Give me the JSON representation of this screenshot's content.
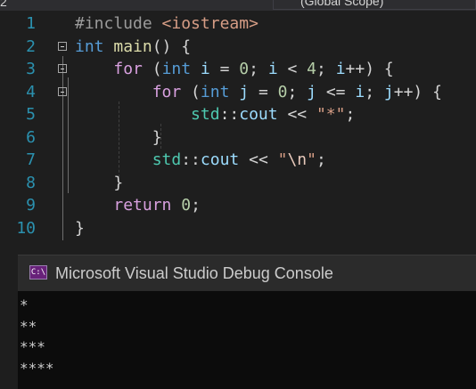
{
  "topbar": {
    "left_fragment": "2",
    "scope_label": "(Global Scope)"
  },
  "editor": {
    "lines": [
      {
        "num": "1",
        "parts": [
          [
            "pp",
            "#include "
          ],
          [
            "str",
            "<iostream>"
          ]
        ]
      },
      {
        "num": "2",
        "parts": [
          [
            "kw",
            "int"
          ],
          [
            "txt",
            " "
          ],
          [
            "fn",
            "main"
          ],
          [
            "txt",
            "() {"
          ]
        ]
      },
      {
        "num": "3",
        "parts": [
          [
            "txt",
            "    "
          ],
          [
            "ctrl",
            "for"
          ],
          [
            "txt",
            " ("
          ],
          [
            "kw",
            "int"
          ],
          [
            "txt",
            " "
          ],
          [
            "var",
            "i"
          ],
          [
            "txt",
            " = "
          ],
          [
            "num",
            "0"
          ],
          [
            "txt",
            "; "
          ],
          [
            "var",
            "i"
          ],
          [
            "txt",
            " < "
          ],
          [
            "num",
            "4"
          ],
          [
            "txt",
            "; "
          ],
          [
            "var",
            "i"
          ],
          [
            "txt",
            "++) {"
          ]
        ]
      },
      {
        "num": "4",
        "parts": [
          [
            "txt",
            "        "
          ],
          [
            "ctrl",
            "for"
          ],
          [
            "txt",
            " ("
          ],
          [
            "kw",
            "int"
          ],
          [
            "txt",
            " "
          ],
          [
            "var",
            "j"
          ],
          [
            "txt",
            " = "
          ],
          [
            "num",
            "0"
          ],
          [
            "txt",
            "; "
          ],
          [
            "var",
            "j"
          ],
          [
            "txt",
            " <= "
          ],
          [
            "var",
            "i"
          ],
          [
            "txt",
            "; "
          ],
          [
            "var",
            "j"
          ],
          [
            "txt",
            "++) {"
          ]
        ]
      },
      {
        "num": "5",
        "parts": [
          [
            "txt",
            "            "
          ],
          [
            "ns",
            "std"
          ],
          [
            "txt",
            "::"
          ],
          [
            "var",
            "cout"
          ],
          [
            "txt",
            " << "
          ],
          [
            "str",
            "\"*\""
          ],
          [
            "txt",
            ";"
          ]
        ]
      },
      {
        "num": "6",
        "parts": [
          [
            "txt",
            "        }"
          ]
        ]
      },
      {
        "num": "7",
        "parts": [
          [
            "txt",
            "        "
          ],
          [
            "ns",
            "std"
          ],
          [
            "txt",
            "::"
          ],
          [
            "var",
            "cout"
          ],
          [
            "txt",
            " << "
          ],
          [
            "str",
            "\""
          ],
          [
            "esc",
            "\\n"
          ],
          [
            "str",
            "\""
          ],
          [
            "txt",
            ";"
          ]
        ]
      },
      {
        "num": "8",
        "parts": [
          [
            "txt",
            "    }"
          ]
        ]
      },
      {
        "num": "9",
        "parts": [
          [
            "txt",
            "    "
          ],
          [
            "ctrl",
            "return"
          ],
          [
            "txt",
            " "
          ],
          [
            "num",
            "0"
          ],
          [
            "txt",
            ";"
          ]
        ]
      },
      {
        "num": "10",
        "parts": [
          [
            "txt",
            "}"
          ]
        ]
      }
    ]
  },
  "console": {
    "title": "Microsoft Visual Studio Debug Console",
    "icon_text": "C:\\",
    "output": [
      "*",
      "**",
      "***",
      "****"
    ]
  },
  "colors": {
    "background": "#1e1e1e",
    "line_number": "#2b91af",
    "keyword": "#569cd6",
    "control": "#d8a0df",
    "string": "#d69d85",
    "number": "#b5cea8",
    "variable": "#9cdcfe",
    "function": "#dcdcaa",
    "namespace": "#4ec9b0"
  }
}
